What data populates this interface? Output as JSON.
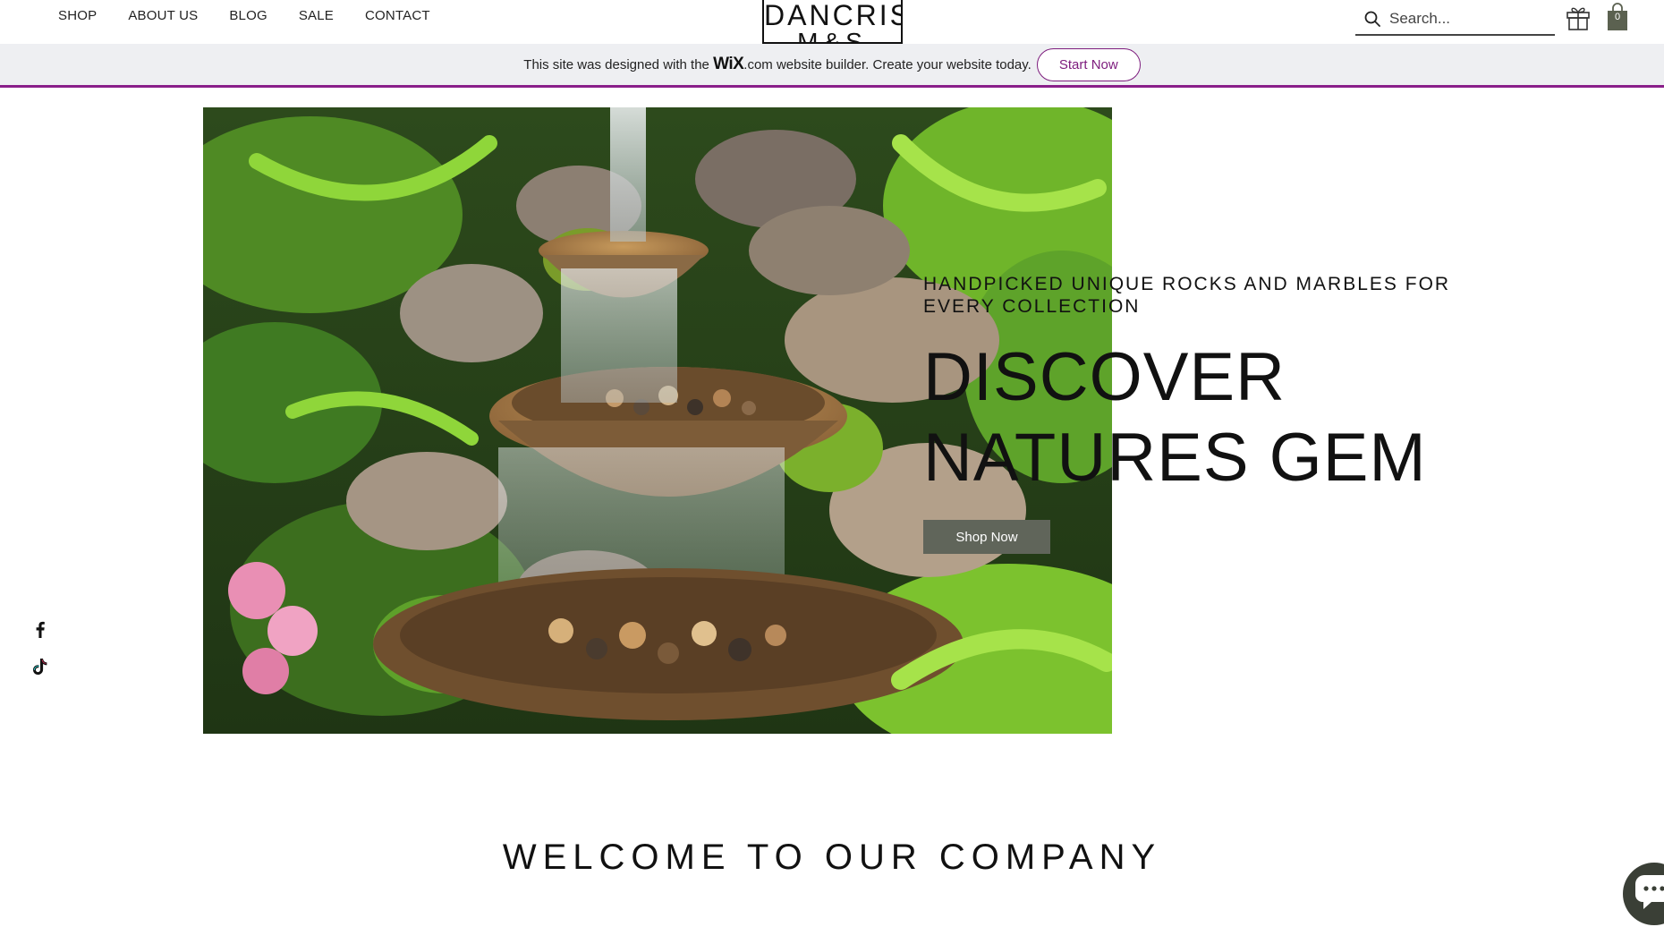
{
  "nav": {
    "items": [
      {
        "label": "SHOP"
      },
      {
        "label": "ABOUT US"
      },
      {
        "label": "BLOG"
      },
      {
        "label": "SALE"
      },
      {
        "label": "CONTACT"
      }
    ]
  },
  "logo": {
    "main": "DANCRIS",
    "sub": "M&S"
  },
  "search": {
    "placeholder": "Search..."
  },
  "cart": {
    "count": "0"
  },
  "banner": {
    "text_before": "This site was designed with the",
    "wix_logo": "WiX",
    "text_after": ".com website builder. Create your website today.",
    "button_label": "Start Now"
  },
  "hero": {
    "tagline": "HANDPICKED UNIQUE ROCKS AND MARBLES FOR EVERY COLLECTION",
    "title_line1": "DISCOVER",
    "title_line2": "NATURES GEM",
    "button_label": "Shop Now"
  },
  "social": {
    "icons": [
      "facebook-icon",
      "tiktok-icon"
    ]
  },
  "welcome": {
    "heading": "WELCOME TO OUR COMPANY"
  },
  "colors": {
    "banner_accent": "#8a1f8a",
    "button_bg": "#60655a",
    "cart_bg": "#5b6150"
  }
}
